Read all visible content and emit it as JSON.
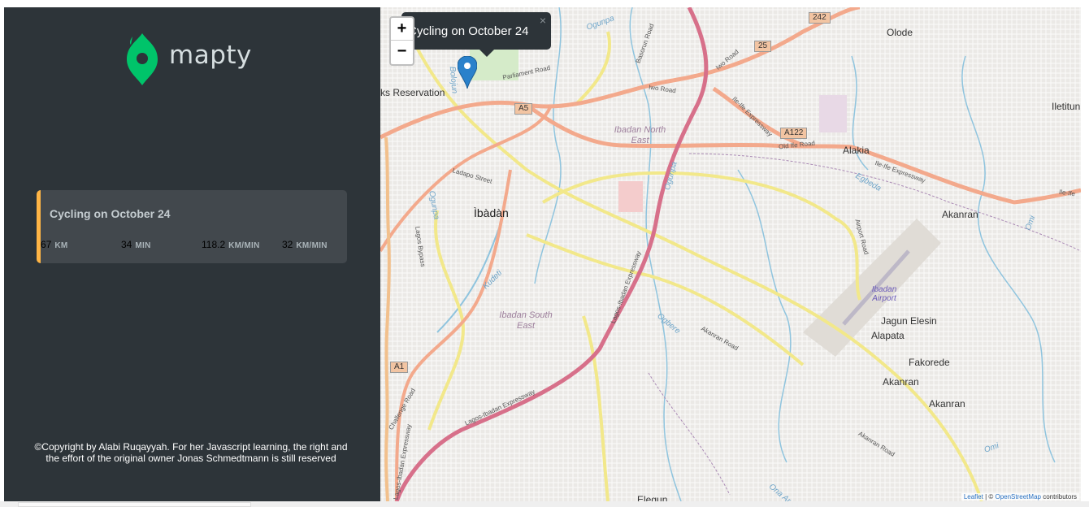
{
  "app": {
    "name": "mapty"
  },
  "sidebar": {
    "logo_text": "mapty",
    "workouts": [
      {
        "title": "Cycling on October 24",
        "type": "cycling",
        "accent_color": "#ffb545",
        "distance": {
          "value": "67",
          "unit": "KM"
        },
        "duration": {
          "value": "34",
          "unit": "MIN"
        },
        "speed": {
          "value": "118.2",
          "unit": "KM/MIN"
        },
        "elevation": {
          "value": "32",
          "unit": "KM/MIN"
        }
      }
    ],
    "copyright": "©Copyright by Alabi Ruqayyah. For her Javascript learning, the right and the effort of the original owner Jonas Schmedtmann is still reserved"
  },
  "map": {
    "zoom_in_label": "+",
    "zoom_out_label": "−",
    "popup": {
      "text": "Cycling on October 24",
      "close_label": "×"
    },
    "marker_icon": "map-pin-icon",
    "labels": {
      "ibadan": "Ìbàdàn",
      "reservation": "ks Reservation",
      "olode": "Olode",
      "iletitun": "Iletitun",
      "alakia": "Alakia",
      "akanran1": "Akanran",
      "akanran2": "Akanran",
      "akanran3": "Akanran",
      "jagun_elesin": "Jagun Elesin",
      "alapata": "Alapata",
      "fakorede": "Fakorede",
      "elegun": "Elegun",
      "ibadan_north_east": "Ibadan North East",
      "ibadan_south_east": "Ibadan South East",
      "ibadan_airport": "Ibadan Airport",
      "parliament_road": "Parliament Road",
      "iwo_road": "Iwo Road",
      "iwo_road2": "Iwo Road",
      "ile_ife_expressway": "Ile-Ife Expressway",
      "ile_ife_expressway2": "Ile-Ife Expressway",
      "ile_ife3": "Ile-Ife",
      "old_ife_road": "Old Ife Road",
      "ladapo_street": "Ladapo Street",
      "lagos_bypass": "Lagos Bypass",
      "airport_road": "Airport Road",
      "akanran_road": "Akanran Road",
      "akanran_road2": "Akanran Road",
      "lagos_ibadan_expressway": "Lagos-Ibadan Expressway",
      "lagos_ibadan_expressway2": "Lagos-Ibadan Expressway",
      "lagos_ibadan_expressway3": "Lagos-Ibadan Expressway",
      "challenge_road": "Challenge Road",
      "basorun_road": "Basorun Road",
      "kudeti": "Kudeti",
      "ogunpa": "Ogunpa",
      "ogunpa2": "Ogunpa",
      "omi": "Omi",
      "omi2": "Omi",
      "egbeda": "Egbeda",
      "ona_ara": "Ona Ara",
      "ogbere": "Ogbere",
      "bolojun": "Bolojun",
      "ogunpa3": "Ogunpa"
    },
    "shields": {
      "a5": "A5",
      "a122": "A122",
      "a1": "A1",
      "r25": "25",
      "r242": "242"
    },
    "attribution": {
      "leaflet": "Leaflet",
      "separator": " | © ",
      "osm": "OpenStreetMap",
      "contributors": " contributors"
    }
  },
  "colors": {
    "sidebar_bg": "#2d3439",
    "card_bg": "#42484d",
    "brand_green": "#00c46a",
    "cycling_accent": "#ffb545",
    "marker_blue": "#2a81cb"
  }
}
